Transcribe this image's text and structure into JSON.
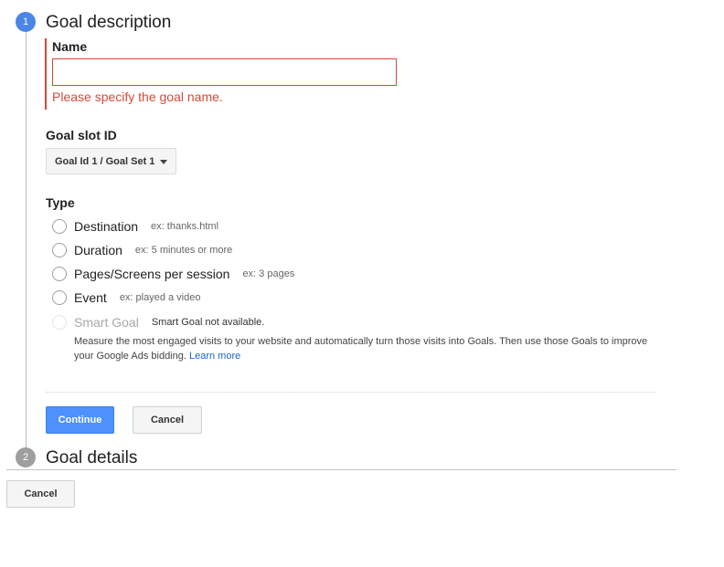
{
  "steps": {
    "step1_number": "1",
    "step1_title": "Goal description",
    "step2_number": "2",
    "step2_title": "Goal details"
  },
  "name_field": {
    "label": "Name",
    "value": "",
    "error": "Please specify the goal name."
  },
  "slot": {
    "label": "Goal slot ID",
    "selected": "Goal Id 1 / Goal Set 1"
  },
  "type": {
    "label": "Type",
    "options": [
      {
        "label": "Destination",
        "example": "ex: thanks.html"
      },
      {
        "label": "Duration",
        "example": "ex: 5 minutes or more"
      },
      {
        "label": "Pages/Screens per session",
        "example": "ex: 3 pages"
      },
      {
        "label": "Event",
        "example": "ex: played a video"
      },
      {
        "label": "Smart Goal",
        "example": "Smart Goal not available.",
        "disabled": true
      }
    ],
    "smart_goal_description": "Measure the most engaged visits to your website and automatically turn those visits into Goals. Then use those Goals to improve your Google Ads bidding.",
    "learn_more": "Learn more"
  },
  "buttons": {
    "continue": "Continue",
    "cancel": "Cancel",
    "bottom_cancel": "Cancel"
  },
  "colors": {
    "accent": "#4a86e8",
    "error": "#d34a38",
    "link": "#1a66c9"
  }
}
